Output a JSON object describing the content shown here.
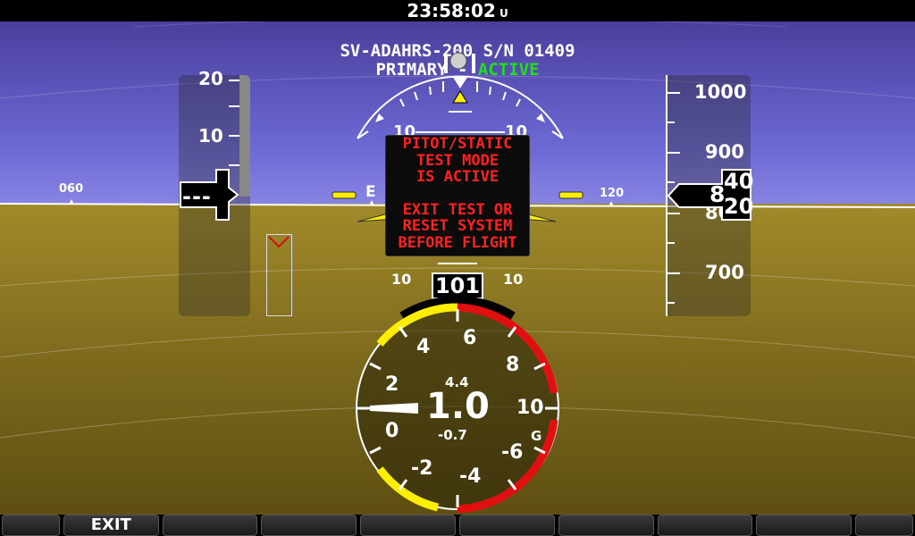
{
  "clock": {
    "time": "23:58:02",
    "suffix": "U"
  },
  "header": {
    "line1": "SV-ADAHRS-200 S/N 01409",
    "line2_prefix": "PRIMARY",
    "line2_status": "ACTIVE"
  },
  "warning": {
    "lines": [
      "PITOT/STATIC",
      "TEST MODE",
      "IS ACTIVE",
      "",
      "EXIT TEST OR",
      "RESET SYSTEM",
      "BEFORE FLIGHT"
    ]
  },
  "heading": {
    "left_tick": "060",
    "right_tick": "120",
    "cardinal": "E"
  },
  "speed_tape": {
    "ticks": [
      "20",
      "10"
    ],
    "current": "---"
  },
  "altitude_tape": {
    "ticks": [
      "1000",
      "900",
      "800",
      "700"
    ],
    "current_hundreds": "8",
    "current_upper": "40",
    "current_lower": "20"
  },
  "pitch_ladder": {
    "upper": "10",
    "lower": "10"
  },
  "heading_box": {
    "value": "101"
  },
  "g_meter": {
    "value": "1.0",
    "max": "4.4",
    "min": "-0.7",
    "unit": "G",
    "scale": [
      "6",
      "4",
      "2",
      "0",
      "-2",
      "-4",
      "-6",
      "10",
      "8"
    ]
  },
  "softkeys": [
    "EXIT",
    "",
    "",
    "",
    "",
    "",
    "",
    "",
    ""
  ],
  "colors": {
    "sky": "#6e6ad6",
    "ground": "#8a7422",
    "warning": "#ff2020",
    "active": "#22dd22",
    "caution": "#ffee00",
    "danger": "#e01010"
  }
}
